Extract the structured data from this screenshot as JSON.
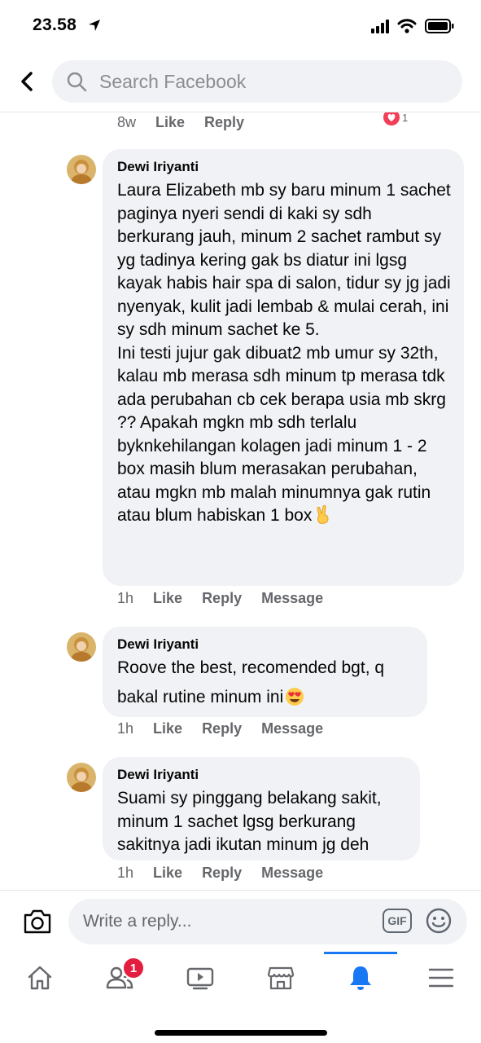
{
  "status_bar": {
    "time": "23.58"
  },
  "search": {
    "placeholder": "Search Facebook"
  },
  "prev_comment_actions": {
    "age": "8w",
    "like": "Like",
    "reply": "Reply",
    "reaction_count": "1"
  },
  "comments": [
    {
      "author": "Dewi Iriyanti",
      "text": "Laura Elizabeth mb sy baru minum 1 sachet paginya nyeri sendi di kaki sy sdh berkurang jauh, minum 2 sachet rambut sy yg tadinya kering gak bs diatur ini lgsg kayak habis hair spa di salon, tidur sy jg jadi nyenyak, kulit jadi lembab & mulai cerah, ini sy sdh minum sachet ke 5.\nIni testi jujur gak dibuat2 mb umur sy 32th, kalau mb merasa sdh minum tp merasa tdk ada perubahan cb cek berapa usia mb skrg ?? Apakah mgkn mb sdh terlalu byknkehilangan kolagen jadi minum 1 - 2 box masih blum merasakan perubahan, atau mgkn mb malah minumnya gak rutin atau blum habiskan 1 box",
      "emoji": "victory-hand-emoji",
      "age": "1h",
      "like": "Like",
      "reply": "Reply",
      "message": "Message"
    },
    {
      "author": "Dewi Iriyanti",
      "text": "Roove the best, recomended bgt, q bakal rutine minum ini",
      "emoji": "heart-eyes-emoji",
      "age": "1h",
      "like": "Like",
      "reply": "Reply",
      "message": "Message"
    },
    {
      "author": "Dewi Iriyanti",
      "text": "Suami sy pinggang belakang sakit, minum 1 sachet lgsg berkurang sakitnya jadi ikutan minum jg deh",
      "age": "1h",
      "like": "Like",
      "reply": "Reply",
      "message": "Message"
    }
  ],
  "composer": {
    "placeholder": "Write a reply...",
    "gif_label": "GIF"
  },
  "tabbar": {
    "items": [
      "home-icon",
      "friends-icon",
      "watch-icon",
      "marketplace-icon",
      "notifications-icon",
      "menu-icon"
    ],
    "active": "notifications",
    "friends_badge": "1"
  },
  "colors": {
    "accent": "#1877f2",
    "badge": "#e41e3f",
    "bubble": "#f0f2f5",
    "meta_text": "#65676b"
  }
}
